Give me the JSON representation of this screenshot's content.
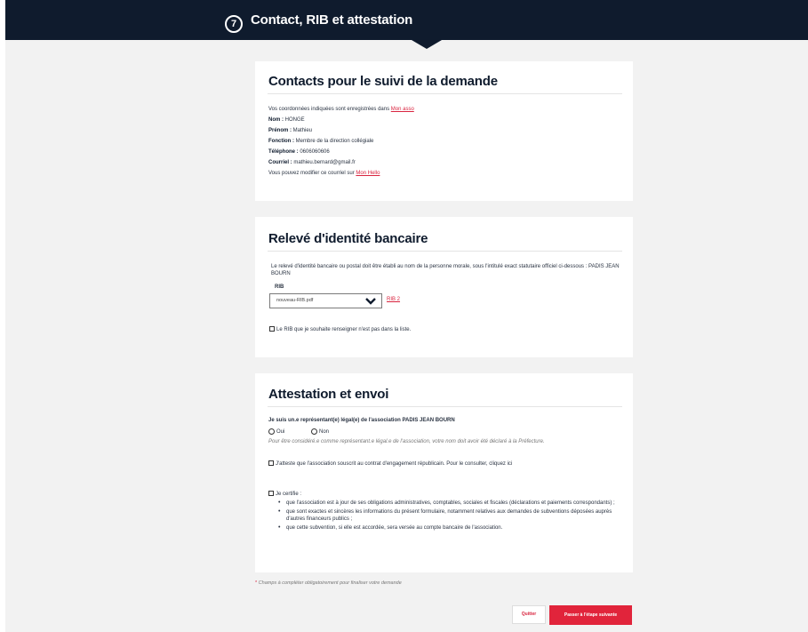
{
  "header": {
    "step_number": "7",
    "title": "Contact, RIB et attestation"
  },
  "contacts": {
    "title": "Contacts pour le suivi de la demande",
    "intro_text": "Vos coordonnées indiquées sont enregistrées dans ",
    "intro_link": "Mon asso",
    "nom_label": "Nom : ",
    "nom_value": "HONGE",
    "prenom_label": "Prénom : ",
    "prenom_value": "Mathieu",
    "fonction_label": "Fonction : ",
    "fonction_value": "Membre de la direction collégiale",
    "telephone_label": "Téléphone : ",
    "telephone_value": "0606060606",
    "courriel_label": "Courriel : ",
    "courriel_value": "mathieu.bernard@gmail.fr",
    "modify_text": "Vous pouvez modifier ce courriel sur ",
    "modify_link": "Mon Hello"
  },
  "rib": {
    "title": "Relevé d'identité bancaire",
    "intro": "Le relevé d'identité bancaire ou postal doit être établi au nom de la personne morale, sous l'intitulé exact statutaire officiel ci-dessous : PADIS JEAN BOURN",
    "select_label": "RIB",
    "select_value": "nouveau-RIB.pdf",
    "link_label": "RIB 2",
    "checkbox_label": "Le RIB que je souhaite renseigner n'est pas dans la liste."
  },
  "attestation": {
    "title": "Attestation et envoi",
    "question": "Je suis un.e représentant(e) légal(e) de l'association PADIS JEAN BOURN",
    "option_yes": "Oui",
    "option_no": "Non",
    "note": "Pour être considéré.e comme représentant.e légal.e de l'association, votre nom doit avoir été déclaré à la Préfecture.",
    "check_engagement": "J'atteste que l'association souscrit au contrat d'engagement républicain. Pour le consulter, cliquez ici",
    "certify_label": "Je certifie :",
    "bullets": [
      "que l'association est à jour de ses obligations administratives, comptables, sociales et fiscales (déclarations et paiements correspondants) ;",
      "que sont exactes et sincères les informations du présent formulaire, notamment relatives aux demandes de subventions déposées auprès d'autres financeurs publics ;",
      "que cette subvention, si elle est accordée, sera versée au compte bancaire de l'association."
    ]
  },
  "footer": {
    "required_star": "*",
    "required_note": " Champs à compléter obligatoirement pour finaliser votre demande",
    "quit_label": "Quitter",
    "next_label": "Passer à l'étape suivante"
  }
}
